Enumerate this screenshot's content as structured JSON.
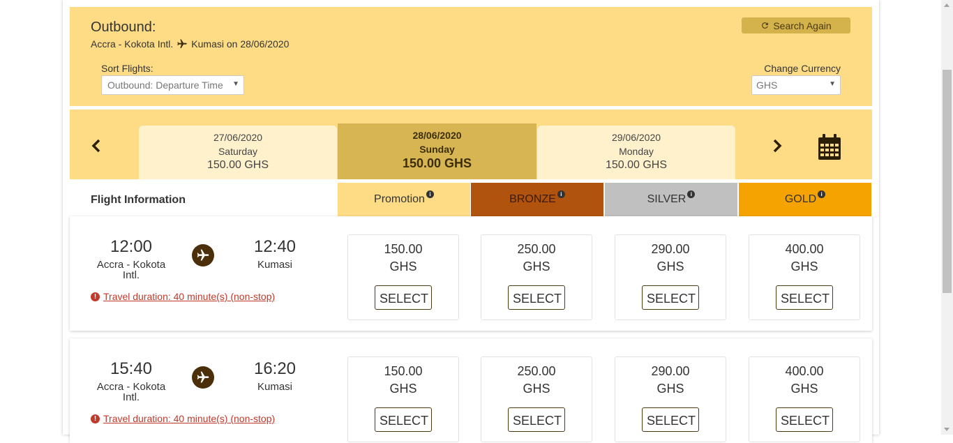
{
  "header": {
    "title": "Outbound:",
    "origin": "Accra - Kokota Intl.",
    "destination_text": "Kumasi on 28/06/2020",
    "search_again": "Search Again",
    "sort_label": "Sort Flights:",
    "sort_value": "Outbound: Departure Time",
    "currency_label": "Change Currency",
    "currency_value": "GHS"
  },
  "dates": [
    {
      "date": "27/06/2020",
      "day": "Saturday",
      "price": "150.00 GHS",
      "active": false
    },
    {
      "date": "28/06/2020",
      "day": "Sunday",
      "price": "150.00 GHS",
      "active": true
    },
    {
      "date": "29/06/2020",
      "day": "Monday",
      "price": "150.00 GHS",
      "active": false
    }
  ],
  "info_header": {
    "label": "Flight Information",
    "tiers": [
      "Promotion",
      "BRONZE",
      "SILVER",
      "GOLD"
    ]
  },
  "colors": {
    "header_bg": "#fddc85",
    "active_tab": "#d8b553",
    "bronze": "#b0530e",
    "silver": "#c0c0c0",
    "gold": "#f5a300",
    "link_red": "#c0392b"
  },
  "flights": [
    {
      "dep_time": "12:00",
      "dep_place": "Accra - Kokota Intl.",
      "arr_time": "12:40",
      "arr_place": "Kumasi",
      "duration": "Travel duration: 40 minute(s) (non-stop)",
      "fares": [
        {
          "amount": "150.00",
          "currency": "GHS",
          "button": "SELECT"
        },
        {
          "amount": "250.00",
          "currency": "GHS",
          "button": "SELECT"
        },
        {
          "amount": "290.00",
          "currency": "GHS",
          "button": "SELECT"
        },
        {
          "amount": "400.00",
          "currency": "GHS",
          "button": "SELECT"
        }
      ]
    },
    {
      "dep_time": "15:40",
      "dep_place": "Accra - Kokota Intl.",
      "arr_time": "16:20",
      "arr_place": "Kumasi",
      "duration": "Travel duration: 40 minute(s) (non-stop)",
      "fares": [
        {
          "amount": "150.00",
          "currency": "GHS",
          "button": "SELECT"
        },
        {
          "amount": "250.00",
          "currency": "GHS",
          "button": "SELECT"
        },
        {
          "amount": "290.00",
          "currency": "GHS",
          "button": "SELECT"
        },
        {
          "amount": "400.00",
          "currency": "GHS",
          "button": "SELECT"
        }
      ]
    }
  ]
}
